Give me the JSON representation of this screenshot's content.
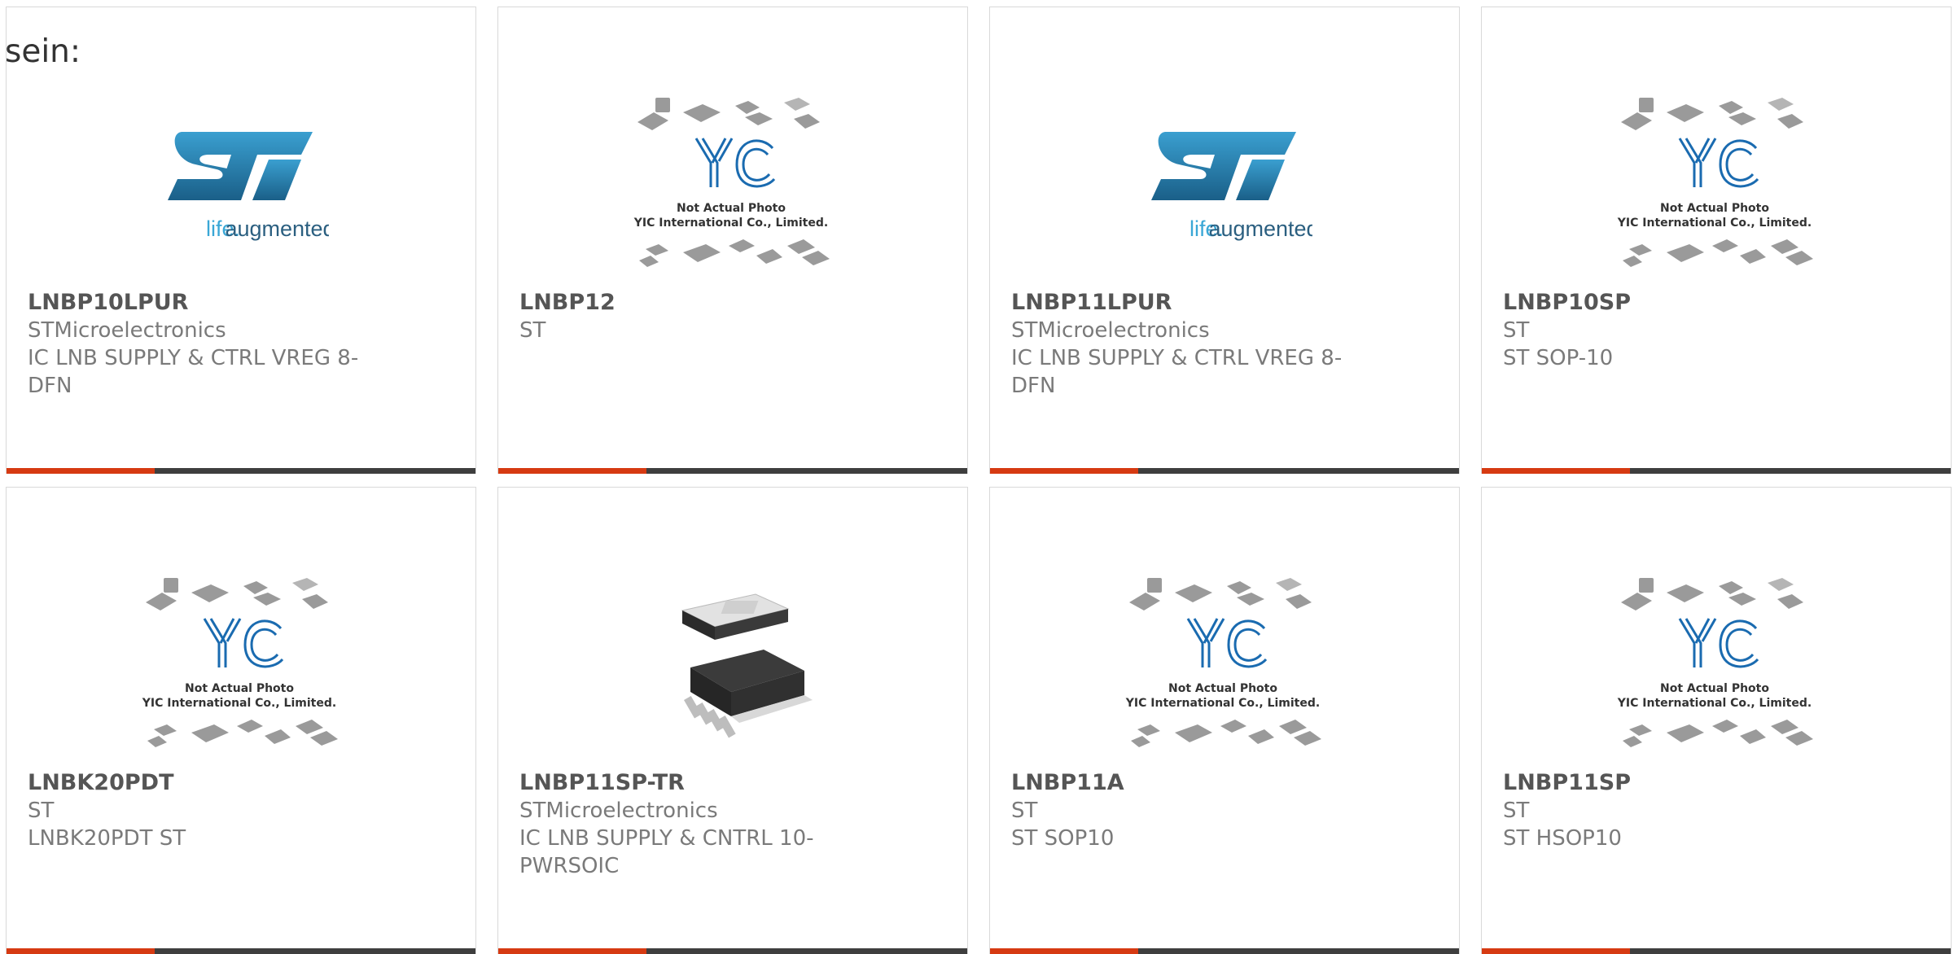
{
  "lead_text": "sein:",
  "colors": {
    "accent": "#d63a12",
    "bar": "#3e3e3e",
    "border": "#d9d9d9"
  },
  "placeholder": {
    "line1": "Not Actual Photo",
    "line2": "YIC International Co., Limited.",
    "logo": "YIC"
  },
  "st_logo": {
    "tagline_a": "life.",
    "tagline_b": "augmented"
  },
  "products": [
    {
      "part": "LNBP10LPUR",
      "mfr": "STMicroelectronics",
      "desc_1": "IC LNB SUPPLY & CTRL VREG 8-",
      "desc_2": "DFN",
      "image": "st-logo"
    },
    {
      "part": "LNBP12",
      "mfr": "ST",
      "desc_1": "",
      "desc_2": "",
      "image": "yic-placeholder"
    },
    {
      "part": "LNBP11LPUR",
      "mfr": "STMicroelectronics",
      "desc_1": "IC LNB SUPPLY & CTRL VREG 8-",
      "desc_2": "DFN",
      "image": "st-logo"
    },
    {
      "part": "LNBP10SP",
      "mfr": "ST",
      "desc_1": "ST SOP-10",
      "desc_2": "",
      "image": "yic-placeholder"
    },
    {
      "part": "LNBK20PDT",
      "mfr": "ST",
      "desc_1": "LNBK20PDT ST",
      "desc_2": "",
      "image": "yic-placeholder"
    },
    {
      "part": "LNBP11SP-TR",
      "mfr": "STMicroelectronics",
      "desc_1": "IC LNB SUPPLY & CNTRL 10-",
      "desc_2": "PWRSOIC",
      "image": "chip-photo"
    },
    {
      "part": "LNBP11A",
      "mfr": "ST",
      "desc_1": "ST SOP10",
      "desc_2": "",
      "image": "yic-placeholder"
    },
    {
      "part": "LNBP11SP",
      "mfr": "ST",
      "desc_1": "ST HSOP10",
      "desc_2": "",
      "image": "yic-placeholder"
    }
  ]
}
